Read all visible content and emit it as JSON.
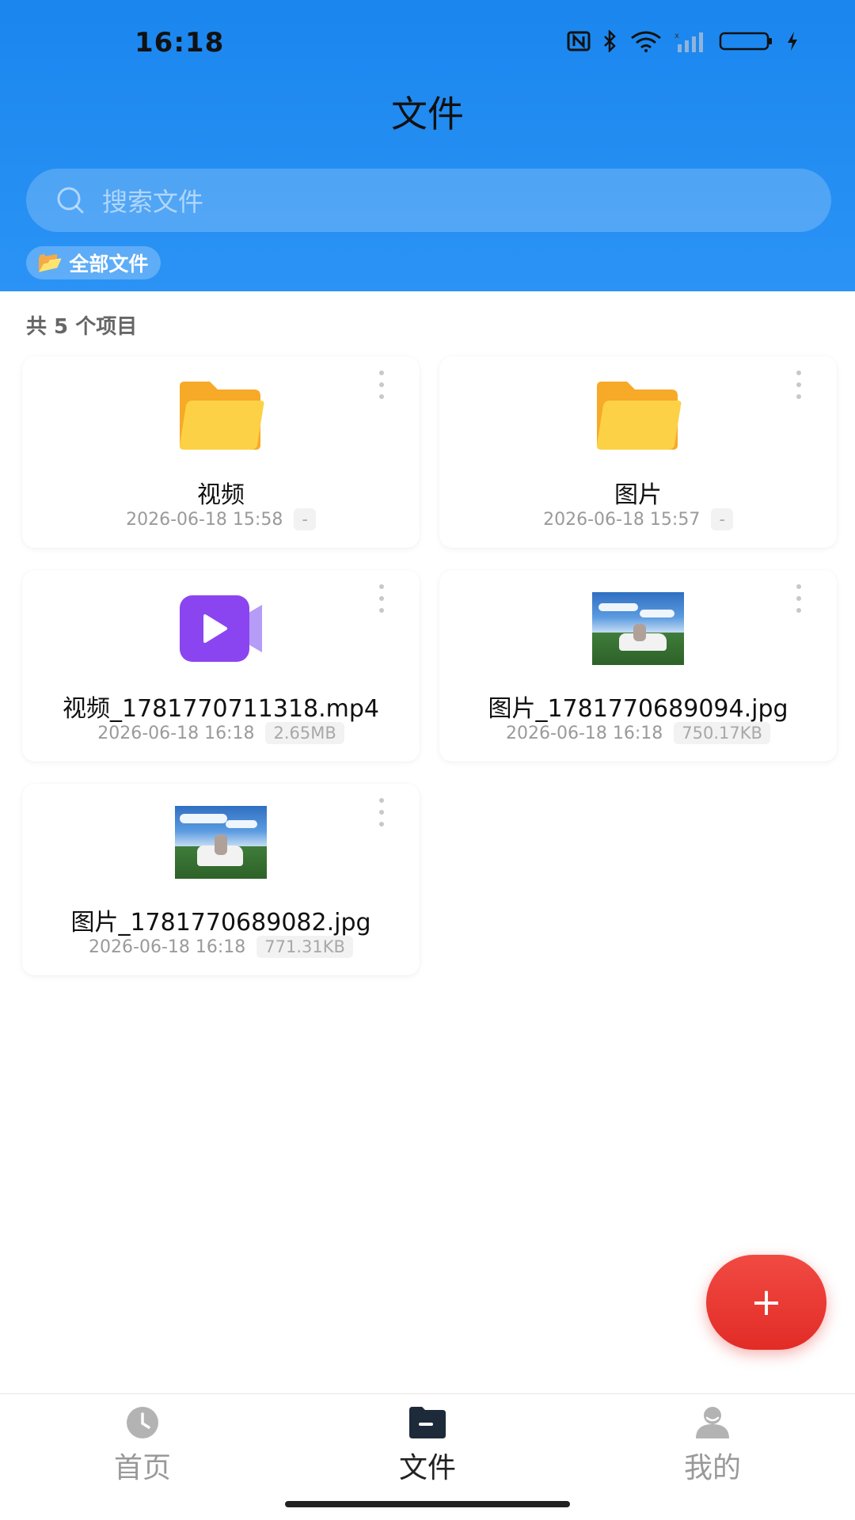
{
  "status_bar": {
    "time": "16:18"
  },
  "header": {
    "title": "文件",
    "search_placeholder": "搜索文件",
    "chip_icon": "📂",
    "chip_label": "全部文件"
  },
  "summary": {
    "count_text": "共 5 个项目"
  },
  "files": [
    {
      "name": "视频",
      "date": "2026-06-18 15:58",
      "size": "-",
      "icon": "folder-icon"
    },
    {
      "name": "图片",
      "date": "2026-06-18 15:57",
      "size": "-",
      "icon": "folder-icon"
    },
    {
      "name": "视频_1781770711318.mp4",
      "date": "2026-06-18 16:18",
      "size": "2.65MB",
      "icon": "video-file-icon"
    },
    {
      "name": "图片_1781770689094.jpg",
      "date": "2026-06-18 16:18",
      "size": "750.17KB",
      "icon": "image-thumbnail"
    },
    {
      "name": "图片_1781770689082.jpg",
      "date": "2026-06-18 16:18",
      "size": "771.31KB",
      "icon": "image-thumbnail"
    }
  ],
  "fab": {
    "label": "+"
  },
  "bottom_nav": [
    {
      "label": "首页",
      "icon": "clock-icon",
      "active": false
    },
    {
      "label": "文件",
      "icon": "folder-icon",
      "active": true
    },
    {
      "label": "我的",
      "icon": "profile-icon",
      "active": false
    }
  ],
  "colors": {
    "header_blue": "#1a86ee",
    "fab_red": "#e8322b",
    "folder_yellow": "#fcc33a",
    "video_purple": "#8b45f0"
  }
}
